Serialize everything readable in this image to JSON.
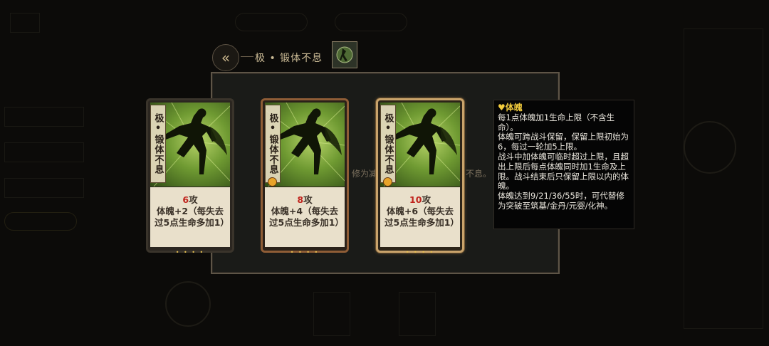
{
  "header": {
    "title": "极 • 锻体不息",
    "back_icon": "double-chevron-left-icon"
  },
  "panel": {
    "behind_text_left": "修为减",
    "behind_text_right": "不息。"
  },
  "cards": [
    {
      "name_chars": "极•锻体不息",
      "attack": "6",
      "attack_unit": "攻",
      "effect": "体魄+2（每失去过5点生命多加1）",
      "frame": "gray"
    },
    {
      "name_chars": "极•锻体不息",
      "attack": "8",
      "attack_unit": "攻",
      "effect": "体魄+4（每失去过5点生命多加1）",
      "frame": "bronze"
    },
    {
      "name_chars": "极•锻体不息",
      "attack": "10",
      "attack_unit": "攻",
      "effect": "体魄+6（每失去过5点生命多加1）",
      "frame": "gold"
    }
  ],
  "tooltip": {
    "icon": "heart-trident-icon",
    "title": "体魄",
    "body": "每1点体魄加1生命上限（不含生命）。\n体魄可跨战斗保留，保留上限初始为6，每过一轮加5上限。\n战斗中加体魄可临时超过上限，且超出上限后每点体魄同时加1生命及上限。战斗结束后只保留上限以内的体魄。\n体魄达到9/21/36/55时，可代替修为突破至筑基/金丹/元婴/化神。"
  },
  "colors": {
    "background": "#0c0b09",
    "attack_number": "#c0241d",
    "tooltip_title": "#f2cc3d",
    "card_art_green": "#8fb845"
  }
}
